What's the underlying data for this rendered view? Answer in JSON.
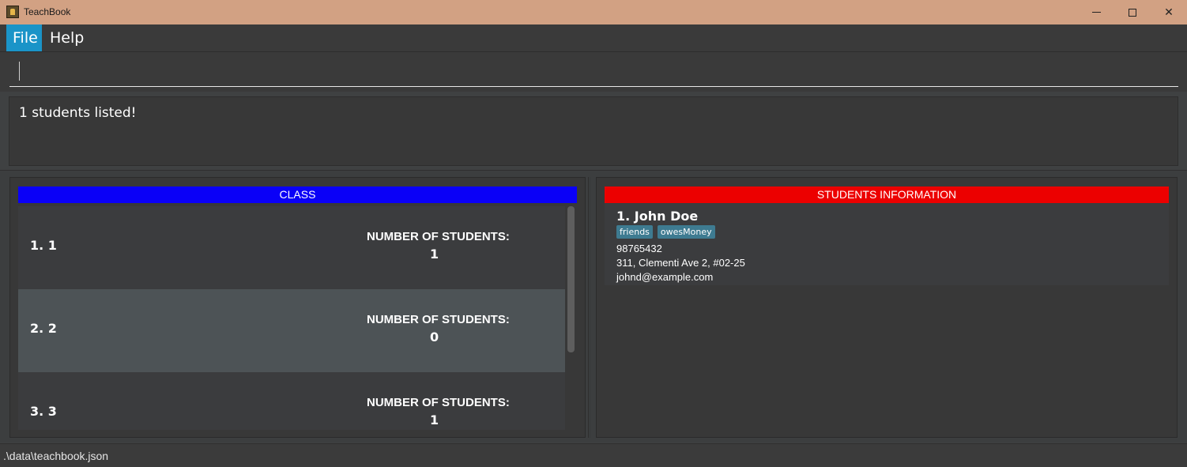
{
  "window": {
    "title": "TeachBook"
  },
  "menu": {
    "file_label": "File",
    "help_label": "Help"
  },
  "command": {
    "value": ""
  },
  "result": {
    "message": "1 students listed!"
  },
  "class_panel": {
    "header": "CLASS",
    "rows": [
      {
        "name": "1. 1",
        "count_label": "NUMBER OF STUDENTS:",
        "count": "1"
      },
      {
        "name": "2. 2",
        "count_label": "NUMBER OF STUDENTS:",
        "count": "0"
      },
      {
        "name": "3. 3",
        "count_label": "NUMBER OF STUDENTS:",
        "count": "1"
      }
    ]
  },
  "students_panel": {
    "header": "STUDENTS INFORMATION",
    "students": [
      {
        "index_name": "1.  John Doe",
        "tags": [
          "friends",
          "owesMoney"
        ],
        "phone": "98765432",
        "address": "311, Clementi Ave 2, #02-25",
        "email": "johnd@example.com"
      }
    ]
  },
  "status": {
    "path": ".\\data\\teachbook.json"
  },
  "colors": {
    "class_header": "#0a00f7",
    "students_header": "#ec0000",
    "menu_selected": "#1a94c8",
    "tag": "#3e7b91"
  }
}
